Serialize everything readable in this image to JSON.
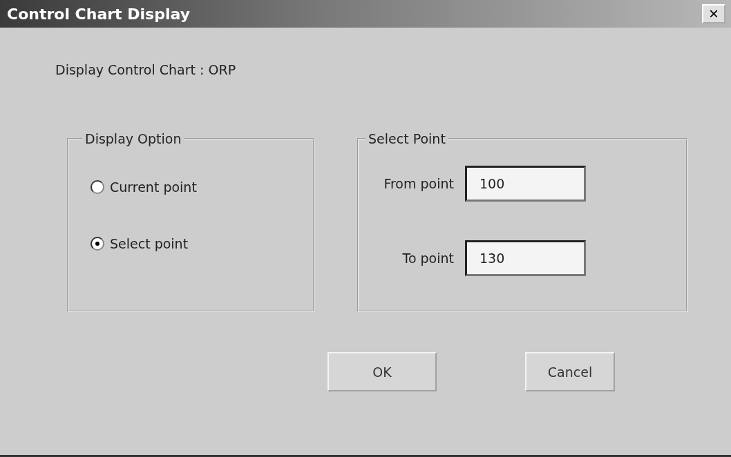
{
  "window": {
    "title": "Control Chart Display",
    "close": "×"
  },
  "heading": "Display Control Chart : ORP",
  "display_option": {
    "title": "Display Option",
    "options": [
      {
        "label": "Current point",
        "selected": false
      },
      {
        "label": "Select  point",
        "selected": true
      }
    ]
  },
  "select_point": {
    "title": "Select Point",
    "fields": [
      {
        "label": "From point",
        "value": "100"
      },
      {
        "label": "To point",
        "value": "130"
      }
    ]
  },
  "buttons": [
    "OK",
    "Cancel"
  ]
}
